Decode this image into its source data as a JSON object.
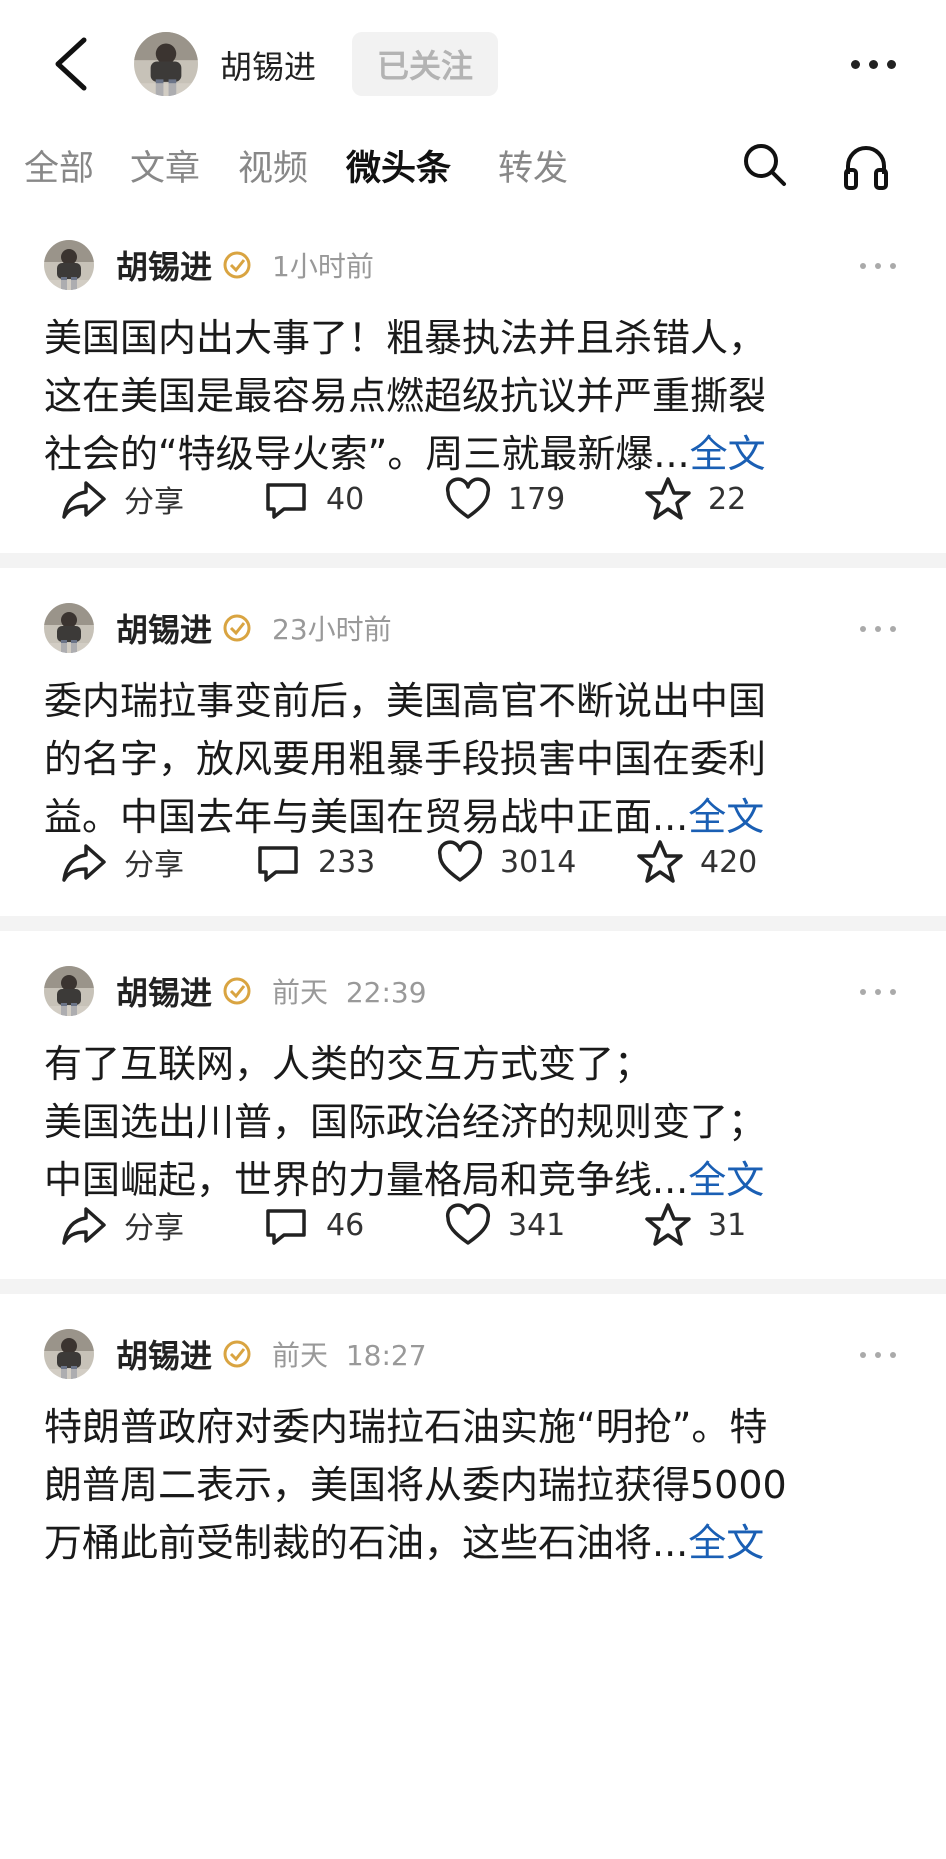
{
  "header": {
    "author": "胡锡进",
    "follow_label": "已关注"
  },
  "tabs": [
    "全部",
    "文章",
    "视频",
    "微头条",
    "转发"
  ],
  "active_tab": "微头条",
  "posts": [
    {
      "author": "胡锡进",
      "time": "1小时前",
      "lines": [
        "美国国内出大事了！粗暴执法并且杀错人，",
        "这在美国是最容易点燃超级抗议并严重撕裂",
        "社会的“特级导火索”。周三就最新爆..."
      ],
      "more_label": "全文",
      "share_label": "分享",
      "comments": "40",
      "likes": "179",
      "favorites": "22"
    },
    {
      "author": "胡锡进",
      "time": "23小时前",
      "lines": [
        "委内瑞拉事变前后，美国高官不断说出中国",
        "的名字，放风要用粗暴手段损害中国在委利",
        "益。中国去年与美国在贸易战中正面..."
      ],
      "more_label": "全文",
      "share_label": "分享",
      "comments": "233",
      "likes": "3014",
      "favorites": "420"
    },
    {
      "author": "胡锡进",
      "time": "前天  22:39",
      "lines": [
        "有了互联网，人类的交互方式变了；",
        "美国选出川普，国际政治经济的规则变了；",
        "中国崛起，世界的力量格局和竞争线..."
      ],
      "more_label": "全文",
      "share_label": "分享",
      "comments": "46",
      "likes": "341",
      "favorites": "31"
    },
    {
      "author": "胡锡进",
      "time": "前天  18:27",
      "lines": [
        "特朗普政府对委内瑞拉石油实施“明抢”。特",
        "朗普周二表示，美国将从委内瑞拉获得5000",
        "万桶此前受制裁的石油，这些石油将..."
      ],
      "more_label": "全文",
      "share_label": "",
      "comments": "",
      "likes": "",
      "favorites": ""
    }
  ],
  "colors": {
    "link": "#1a5fb4",
    "verified": "#d9a441",
    "page_bg": "#f3f3f3"
  }
}
